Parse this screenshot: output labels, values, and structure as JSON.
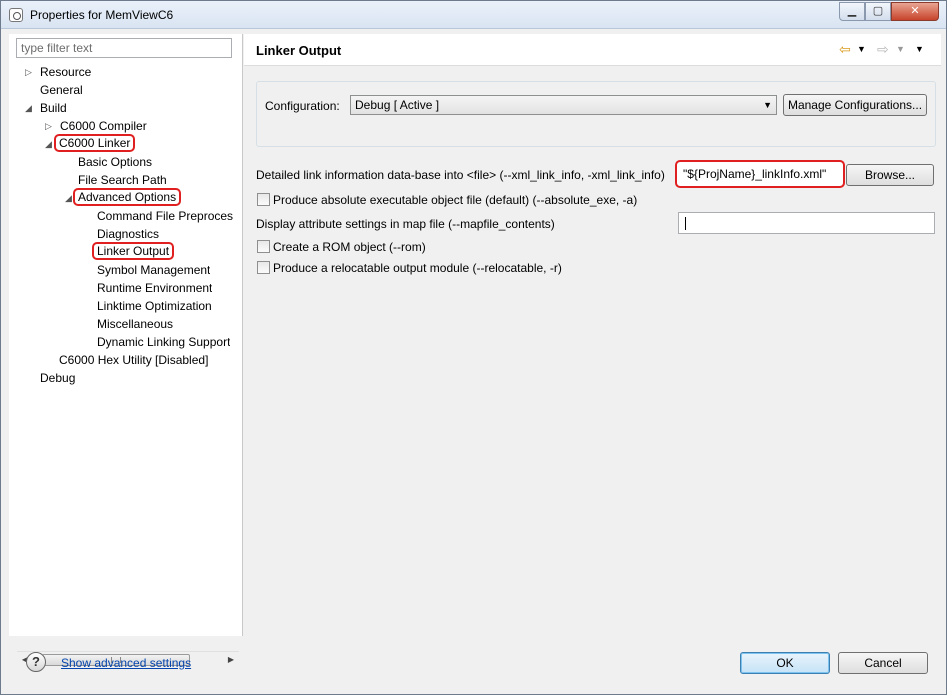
{
  "window": {
    "title": "Properties for MemViewC6",
    "minimize": "▁",
    "maximize": "▢",
    "close": "✕"
  },
  "filter": {
    "placeholder": "type filter text"
  },
  "tree": {
    "resource": "Resource",
    "general": "General",
    "build": "Build",
    "compiler": "C6000 Compiler",
    "linker": "C6000 Linker",
    "basic_options": "Basic Options",
    "file_search_path": "File Search Path",
    "advanced_options": "Advanced Options",
    "command_file": "Command File Preprocessing",
    "diagnostics": "Diagnostics",
    "linker_output": "Linker Output",
    "symbol_management": "Symbol Management",
    "runtime_environment": "Runtime Environment",
    "linktime_optimization": "Linktime Optimization",
    "miscellaneous": "Miscellaneous",
    "dynamic_linking": "Dynamic Linking Support",
    "hex_utility": "C6000 Hex Utility  [Disabled]",
    "debug": "Debug"
  },
  "page": {
    "title": "Linker Output"
  },
  "config": {
    "label": "Configuration:",
    "value": "Debug  [ Active ]",
    "manage_label": "Manage Configurations..."
  },
  "options": {
    "xml_link_info_label": "Detailed link information data-base into <file> (--xml_link_info, -xml_link_info)",
    "xml_link_info_value": "\"${ProjName}_linkInfo.xml\"",
    "browse_label": "Browse...",
    "absolute_exe_label": "Produce absolute executable object file (default) (--absolute_exe, -a)",
    "mapfile_contents_label": "Display attribute settings in map file (--mapfile_contents)",
    "rom_label": "Create a ROM object (--rom)",
    "relocatable_label": "Produce a relocatable output module (--relocatable, -r)"
  },
  "footer": {
    "help": "?",
    "advanced_link": "Show advanced settings",
    "ok_label": "OK",
    "cancel_label": "Cancel"
  },
  "colors": {
    "highlight": "#e02020",
    "link": "#0645ad"
  }
}
